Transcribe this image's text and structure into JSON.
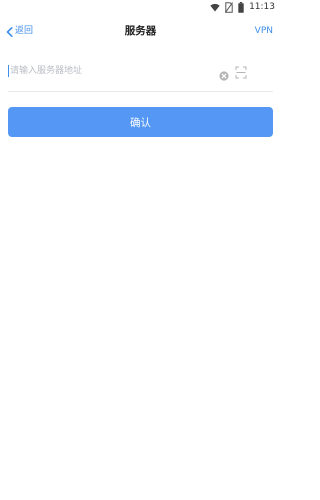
{
  "status_bar": {
    "time": "11:13",
    "icons": [
      "wifi-icon",
      "no-sim-icon",
      "battery-icon"
    ]
  },
  "nav": {
    "back_label": "返回",
    "title": "服务器",
    "right_label": "VPN"
  },
  "form": {
    "server_input": {
      "value": "",
      "placeholder": "请输入服务器地址"
    },
    "confirm_label": "确认"
  },
  "colors": {
    "accent": "#3f8ee9",
    "button": "#5497f5",
    "placeholder": "#b9bdc4"
  }
}
